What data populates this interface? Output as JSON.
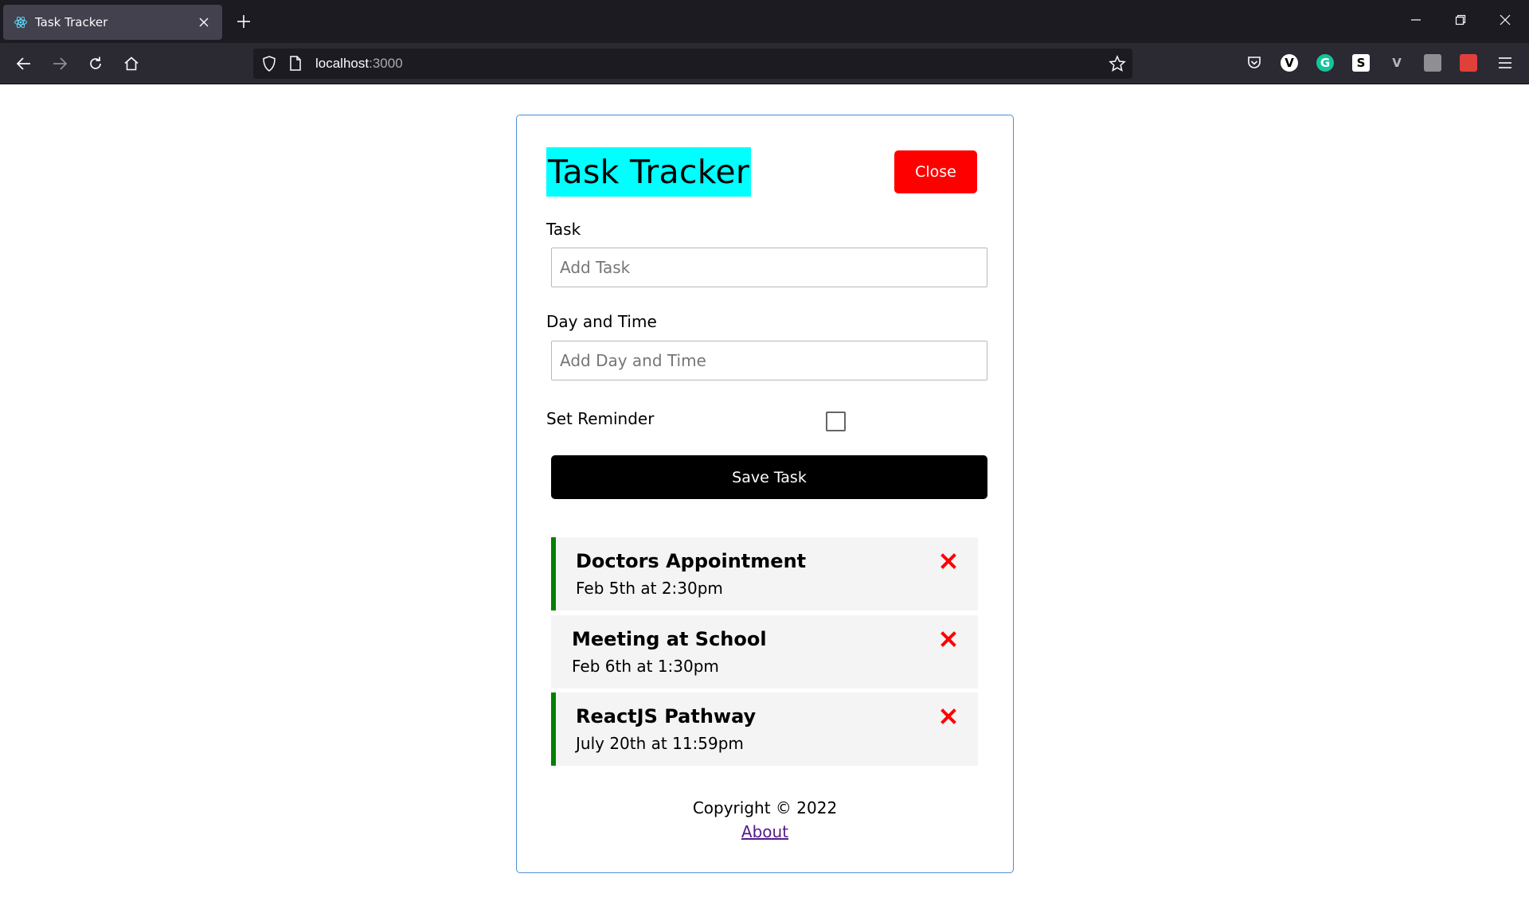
{
  "browser": {
    "tab_title": "Task Tracker",
    "url_host": "localhost",
    "url_port": ":3000",
    "icons": [
      "react-logo-icon",
      "close-icon",
      "plus-icon",
      "minimize-icon",
      "restore-icon",
      "back-arrow-icon",
      "forward-arrow-icon",
      "reload-icon",
      "home-icon",
      "shield-icon",
      "page-icon",
      "star-icon",
      "pocket-icon",
      "menu-icon"
    ],
    "extensions": [
      {
        "name": "vimeo-extension-icon",
        "letter": "V",
        "bg": "#ffffff",
        "fg": "#000000"
      },
      {
        "name": "grammarly-extension-icon",
        "letter": "G",
        "bg": "#15c39a",
        "fg": "#ffffff"
      },
      {
        "name": "s-extension-icon",
        "letter": "S",
        "bg": "#ffffff",
        "fg": "#000000"
      },
      {
        "name": "vue-devtools-extension-icon",
        "letter": "V",
        "bg": "#2b2a33",
        "fg": "#b7b7b7"
      },
      {
        "name": "gray-extension-icon",
        "letter": "",
        "bg": "#8e8e93",
        "fg": "#ffffff"
      },
      {
        "name": "red-extension-icon",
        "letter": "",
        "bg": "#e0403a",
        "fg": "#ffffff"
      }
    ]
  },
  "header": {
    "title": "Task Tracker",
    "close_label": "Close",
    "title_bg": "#00ffff",
    "close_bg": "#ff0000"
  },
  "form": {
    "task_label": "Task",
    "task_placeholder": "Add Task",
    "task_value": "",
    "day_label": "Day and Time",
    "day_placeholder": "Add Day and Time",
    "day_value": "",
    "reminder_label": "Set Reminder",
    "reminder_checked": false,
    "save_label": "Save Task"
  },
  "tasks": [
    {
      "text": "Doctors Appointment",
      "day": "Feb 5th at 2:30pm",
      "reminder": true
    },
    {
      "text": "Meeting at School",
      "day": "Feb 6th at 1:30pm",
      "reminder": false
    },
    {
      "text": "ReactJS Pathway",
      "day": "July 20th at 11:59pm",
      "reminder": true
    }
  ],
  "colors": {
    "reminder_border": "#008000",
    "delete_icon": "#ff0000",
    "container_border": "#4a8fd6"
  },
  "footer": {
    "copyright": "Copyright © 2022",
    "about_link": "About"
  }
}
